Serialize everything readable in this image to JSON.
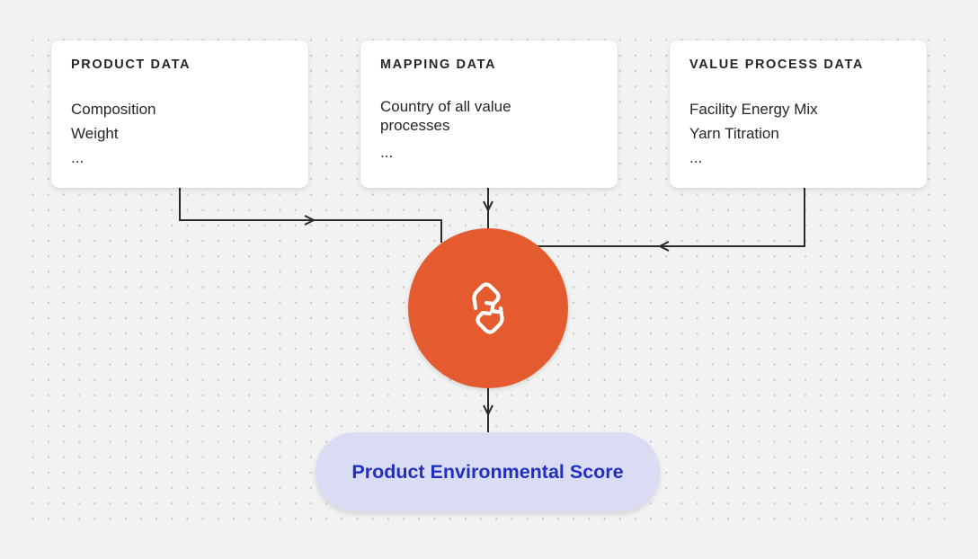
{
  "diagram": {
    "inputs": [
      {
        "id": "product",
        "title": "PRODUCT DATA",
        "items": [
          "Composition",
          "Weight",
          "..."
        ]
      },
      {
        "id": "mapping",
        "title": "MAPPING DATA",
        "items": [
          "Country of all value processes",
          "..."
        ]
      },
      {
        "id": "value",
        "title": "VALUE PROCESS DATA",
        "items": [
          "Facility Energy Mix",
          "Yarn Titration",
          "..."
        ]
      }
    ],
    "hub": {
      "icon": "chain-link-logo-icon",
      "color": "#E35B2E"
    },
    "output": {
      "label": "Product Environmental Score",
      "background": "#DADCF3",
      "text_color": "#2230C2"
    },
    "edges": [
      {
        "from": "product",
        "to": "hub"
      },
      {
        "from": "mapping",
        "to": "hub"
      },
      {
        "from": "value",
        "to": "hub"
      },
      {
        "from": "hub",
        "to": "output"
      }
    ]
  }
}
